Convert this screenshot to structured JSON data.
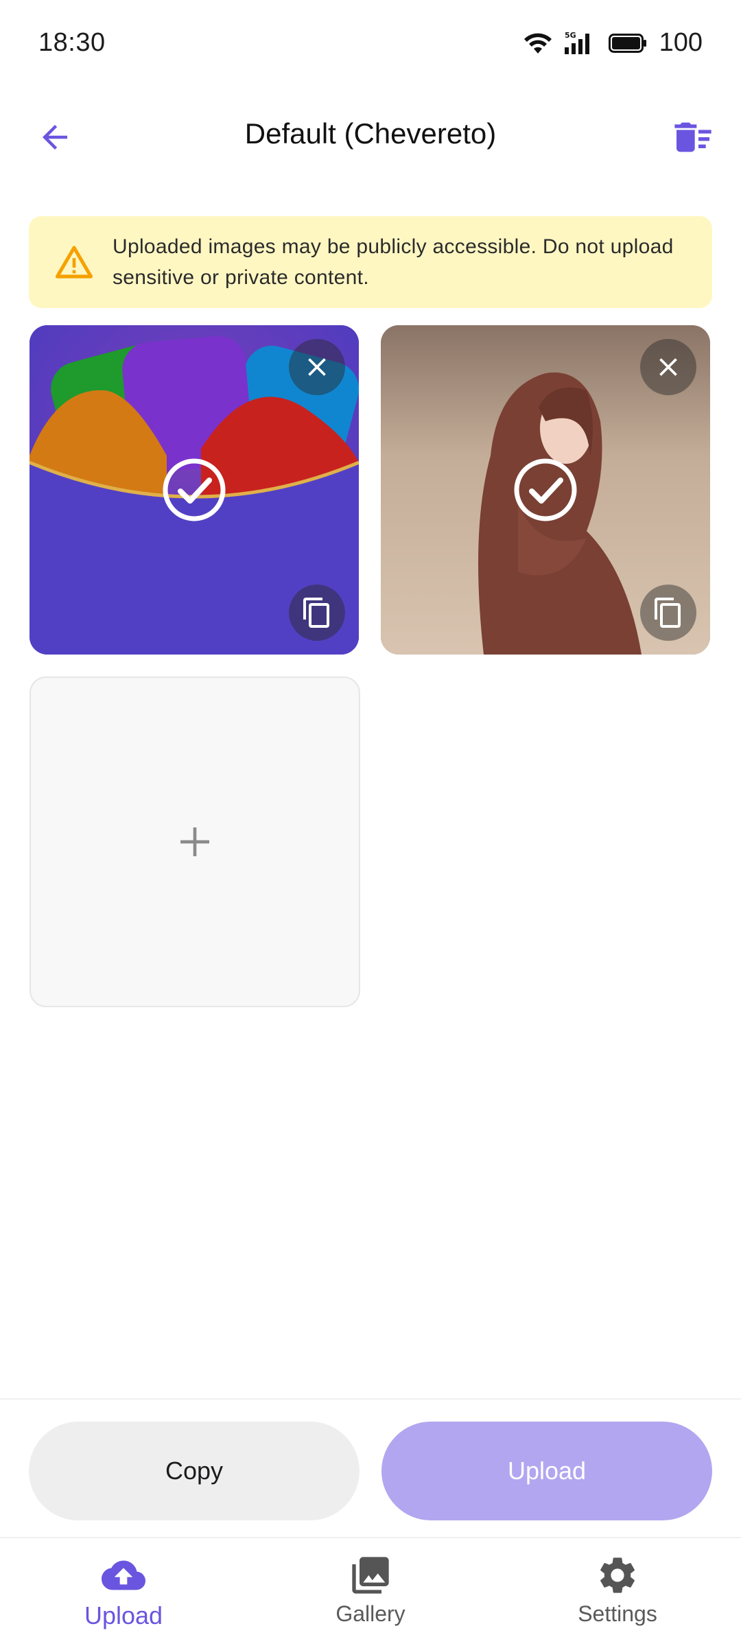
{
  "status_bar": {
    "time": "18:30",
    "network": "5G",
    "battery": "100"
  },
  "header": {
    "title": "Default (Chevereto)",
    "back_icon": "arrow-left-icon",
    "clear_icon": "delete-sweep-icon"
  },
  "warning": {
    "icon": "warning-triangle-icon",
    "text": "Uploaded images may be publicly accessible. Do not upload sensitive or private content."
  },
  "images": [
    {
      "name": "app-logo-image",
      "selected": true
    },
    {
      "name": "woman-in-brown-hood-photo",
      "selected": true
    }
  ],
  "add_tile": {
    "icon": "plus-icon"
  },
  "actions": {
    "copy_label": "Copy",
    "upload_label": "Upload"
  },
  "nav": {
    "items": [
      {
        "label": "Upload",
        "icon": "cloud-upload-icon",
        "active": true
      },
      {
        "label": "Gallery",
        "icon": "gallery-icon",
        "active": false
      },
      {
        "label": "Settings",
        "icon": "gear-icon",
        "active": false
      }
    ]
  },
  "colors": {
    "accent": "#6a55e0",
    "upload_button_disabled": "#b2a6f0",
    "warning_bg": "#fff7c2",
    "warning_icon": "#f5a100"
  }
}
